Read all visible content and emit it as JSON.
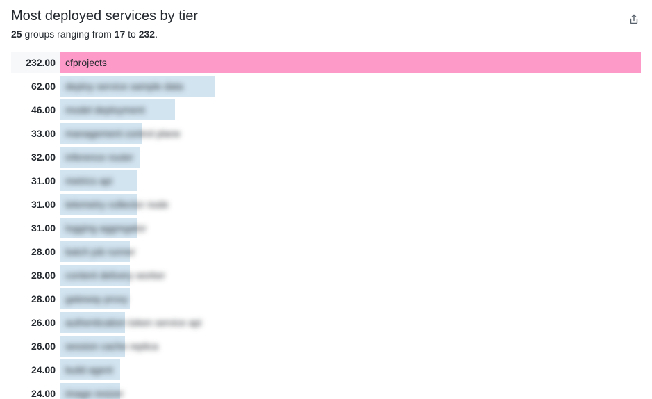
{
  "header": {
    "title": "Most deployed services by tier",
    "groups_count": "25",
    "subtitle_mid1": " groups ranging from ",
    "range_min": "17",
    "subtitle_mid2": " to ",
    "range_max": "232",
    "subtitle_end": ".",
    "share_icon_name": "share-icon"
  },
  "chart_data": {
    "type": "bar",
    "orientation": "horizontal",
    "title": "Most deployed services by tier",
    "xlabel": "",
    "ylabel": "",
    "xlim": [
      0,
      232
    ],
    "max_value": 232,
    "groups_total": 25,
    "range": [
      17,
      232
    ],
    "series": [
      {
        "value": 232.0,
        "label": "cfprojects",
        "highlight": true,
        "redacted": false
      },
      {
        "value": 62.0,
        "label": "deploy service sample data",
        "highlight": false,
        "redacted": true
      },
      {
        "value": 46.0,
        "label": "model deployment",
        "highlight": false,
        "redacted": true
      },
      {
        "value": 33.0,
        "label": "management control plane",
        "highlight": false,
        "redacted": true
      },
      {
        "value": 32.0,
        "label": "inference router",
        "highlight": false,
        "redacted": true
      },
      {
        "value": 31.0,
        "label": "metrics api",
        "highlight": false,
        "redacted": true
      },
      {
        "value": 31.0,
        "label": "telemetry collector node",
        "highlight": false,
        "redacted": true
      },
      {
        "value": 31.0,
        "label": "logging aggregator",
        "highlight": false,
        "redacted": true
      },
      {
        "value": 28.0,
        "label": "batch job runner",
        "highlight": false,
        "redacted": true
      },
      {
        "value": 28.0,
        "label": "content delivery worker",
        "highlight": false,
        "redacted": true
      },
      {
        "value": 28.0,
        "label": "gateway proxy",
        "highlight": false,
        "redacted": true
      },
      {
        "value": 26.0,
        "label": "authentication token service api",
        "highlight": false,
        "redacted": true
      },
      {
        "value": 26.0,
        "label": "session cache replica",
        "highlight": false,
        "redacted": true
      },
      {
        "value": 24.0,
        "label": "build agent",
        "highlight": false,
        "redacted": true
      },
      {
        "value": 24.0,
        "label": "image resizer",
        "highlight": false,
        "redacted": true
      }
    ]
  }
}
